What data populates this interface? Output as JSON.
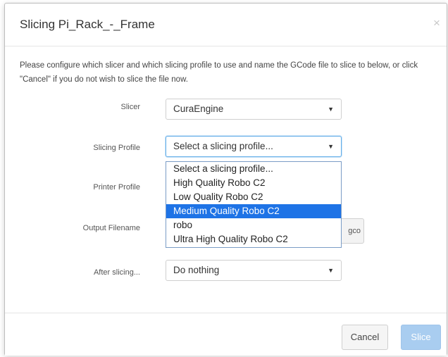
{
  "dialog": {
    "title": "Slicing Pi_Rack_-_Frame",
    "close_symbol": "×",
    "intro": "Please configure which slicer and which slicing profile to use and name the GCode file to slice to below, or click \"Cancel\" if you do not wish to slice the file now."
  },
  "form": {
    "slicer": {
      "label": "Slicer",
      "value": "CuraEngine"
    },
    "slicing_profile": {
      "label": "Slicing Profile",
      "value": "Select a slicing profile...",
      "options": [
        "Select a slicing profile...",
        "High Quality Robo C2",
        "Low Quality Robo C2",
        "Medium Quality Robo C2",
        "robo",
        "Ultra High Quality Robo C2"
      ],
      "highlighted_option": "Medium Quality Robo C2"
    },
    "printer_profile": {
      "label": "Printer Profile"
    },
    "output_filename": {
      "label": "Output Filename",
      "suffix_text": "gco"
    },
    "after_slicing": {
      "label": "After slicing...",
      "value": "Do nothing"
    },
    "caret_symbol": "▼"
  },
  "footer": {
    "cancel_label": "Cancel",
    "slice_label": "Slice"
  },
  "colors": {
    "highlight": "#1e73e6",
    "primary_disabled": "#a9cdf0"
  }
}
